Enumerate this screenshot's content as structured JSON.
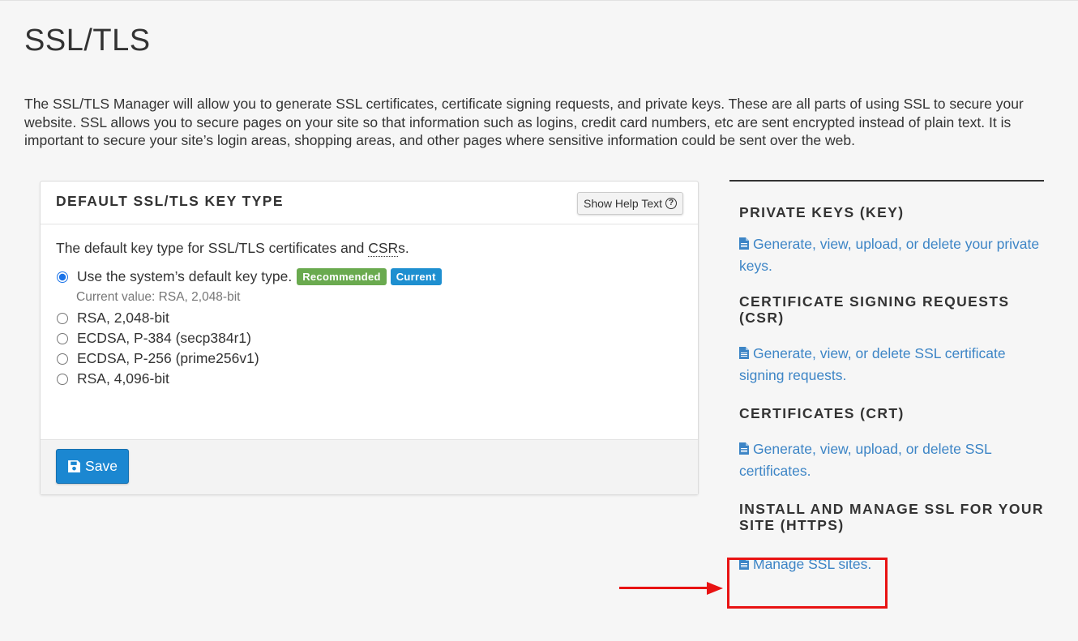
{
  "page": {
    "title": "SSL/TLS",
    "intro": "The SSL/TLS Manager will allow you to generate SSL certificates, certificate signing requests, and private keys. These are all parts of using SSL to secure your website. SSL allows you to secure pages on your site so that information such as logins, credit card numbers, etc are sent encrypted instead of plain text. It is important to secure your site’s login areas, shopping areas, and other pages where sensitive information could be sent over the web."
  },
  "panel": {
    "title": "DEFAULT SSL/TLS KEY TYPE",
    "help_button": "Show Help Text",
    "description_prefix": "The default key type for SSL/TLS certificates and ",
    "description_abbr": "CSR",
    "description_suffix": "s.",
    "options": [
      {
        "label": "Use the system’s default key type.",
        "checked": true
      },
      {
        "label": "RSA, 2,048-bit",
        "checked": false
      },
      {
        "label": "ECDSA, P-384 (secp384r1)",
        "checked": false
      },
      {
        "label": "ECDSA, P-256 (prime256v1)",
        "checked": false
      },
      {
        "label": "RSA, 4,096-bit",
        "checked": false
      }
    ],
    "badges": {
      "recommended": "Recommended",
      "current": "Current"
    },
    "current_value": "Current value: RSA, 2,048-bit",
    "save_label": "Save"
  },
  "sidebar": {
    "sections": [
      {
        "title": "PRIVATE KEYS (KEY)",
        "link": "Generate, view, upload, or delete your private keys."
      },
      {
        "title": "CERTIFICATE SIGNING REQUESTS (CSR)",
        "link": "Generate, view, or delete SSL certificate signing requests."
      },
      {
        "title": "CERTIFICATES (CRT)",
        "link": "Generate, view, upload, or delete SSL certificates."
      },
      {
        "title": "INSTALL AND MANAGE SSL FOR YOUR SITE (HTTPS)",
        "link": "Manage SSL sites."
      }
    ]
  },
  "colors": {
    "link": "#3d85c6",
    "save_button": "#1b87d1",
    "badge_recommended": "#6aaa4f",
    "badge_current": "#1e8fd0",
    "annotation": "#e81313"
  }
}
